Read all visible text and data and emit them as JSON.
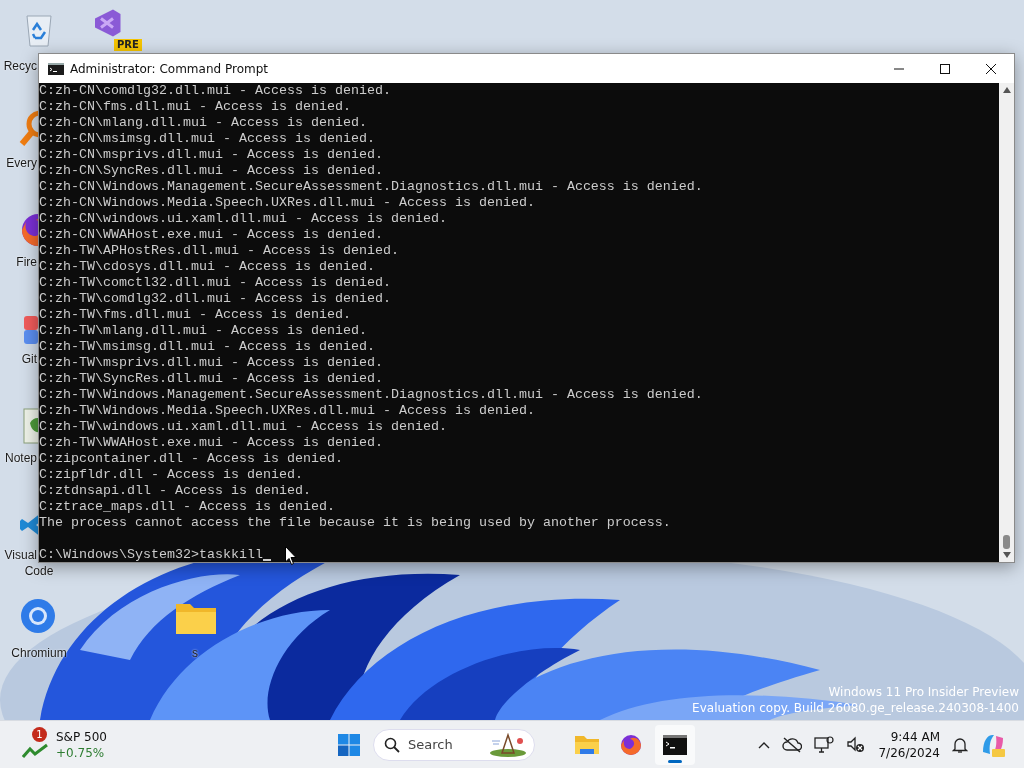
{
  "desktop": {
    "icons": [
      {
        "kind": "recycle",
        "label": [
          "Recyc"
        ]
      },
      {
        "kind": "studio",
        "badge": "PRE"
      },
      {
        "kind": "everything",
        "label": [
          "Every"
        ]
      },
      {
        "kind": "firefox",
        "label": [
          "Fire"
        ]
      },
      {
        "kind": "git",
        "label": [
          "Git"
        ]
      },
      {
        "kind": "notepad",
        "label": [
          "Notep"
        ]
      },
      {
        "kind": "vscode",
        "label": [
          "Visual",
          "Code"
        ]
      },
      {
        "kind": "chromium",
        "label": [
          "Chromium"
        ]
      },
      {
        "kind": "folder",
        "label": [
          "s"
        ]
      }
    ],
    "watermark": [
      "Windows 11 Pro Insider Preview",
      "Evaluation copy. Build 26080.ge_release.240308-1400"
    ]
  },
  "window": {
    "title": "Administrator: Command Prompt",
    "lines": [
      "C:zh-CN\\comdlg32.dll.mui - Access is denied.",
      "C:zh-CN\\fms.dll.mui - Access is denied.",
      "C:zh-CN\\mlang.dll.mui - Access is denied.",
      "C:zh-CN\\msimsg.dll.mui - Access is denied.",
      "C:zh-CN\\msprivs.dll.mui - Access is denied.",
      "C:zh-CN\\SyncRes.dll.mui - Access is denied.",
      "C:zh-CN\\Windows.Management.SecureAssessment.Diagnostics.dll.mui - Access is denied.",
      "C:zh-CN\\Windows.Media.Speech.UXRes.dll.mui - Access is denied.",
      "C:zh-CN\\windows.ui.xaml.dll.mui - Access is denied.",
      "C:zh-CN\\WWAHost.exe.mui - Access is denied.",
      "C:zh-TW\\APHostRes.dll.mui - Access is denied.",
      "C:zh-TW\\cdosys.dll.mui - Access is denied.",
      "C:zh-TW\\comctl32.dll.mui - Access is denied.",
      "C:zh-TW\\comdlg32.dll.mui - Access is denied.",
      "C:zh-TW\\fms.dll.mui - Access is denied.",
      "C:zh-TW\\mlang.dll.mui - Access is denied.",
      "C:zh-TW\\msimsg.dll.mui - Access is denied.",
      "C:zh-TW\\msprivs.dll.mui - Access is denied.",
      "C:zh-TW\\SyncRes.dll.mui - Access is denied.",
      "C:zh-TW\\Windows.Management.SecureAssessment.Diagnostics.dll.mui - Access is denied.",
      "C:zh-TW\\Windows.Media.Speech.UXRes.dll.mui - Access is denied.",
      "C:zh-TW\\windows.ui.xaml.dll.mui - Access is denied.",
      "C:zh-TW\\WWAHost.exe.mui - Access is denied.",
      "C:zipcontainer.dll - Access is denied.",
      "C:zipfldr.dll - Access is denied.",
      "C:ztdnsapi.dll - Access is denied.",
      "C:ztrace_maps.dll - Access is denied.",
      "The process cannot access the file because it is being used by another process."
    ],
    "prompt": "C:\\Windows\\System32>taskkill"
  },
  "taskbar": {
    "widget": {
      "badge": "1",
      "title": "S&P 500",
      "change": "+0.75%"
    },
    "search": {
      "placeholder": "Search"
    },
    "apps": [
      {
        "kind": "explorer",
        "selected": false
      },
      {
        "kind": "firefox",
        "selected": false
      },
      {
        "kind": "terminal",
        "selected": true
      }
    ],
    "clock": {
      "time": "9:44 AM",
      "date": "7/26/2024"
    }
  }
}
